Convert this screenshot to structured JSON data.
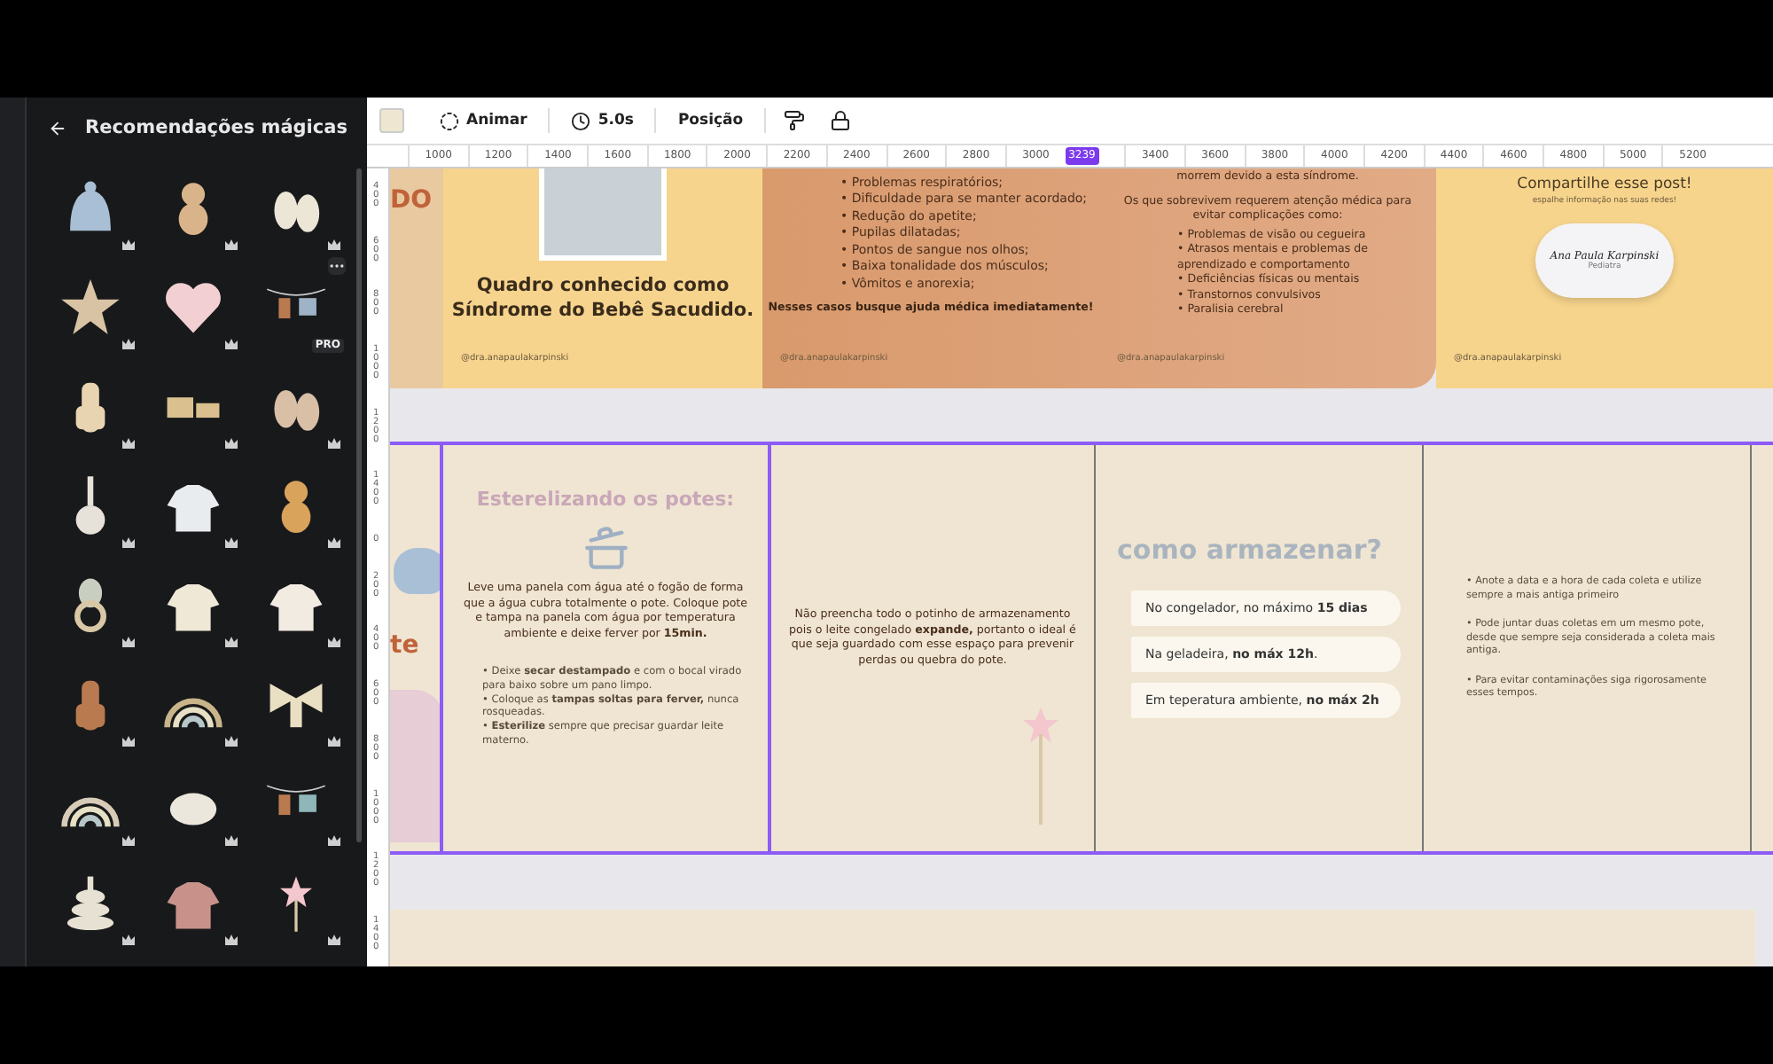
{
  "sidebar": {
    "title": "Recomendações mágicas",
    "stickers": [
      {
        "kind": "hat",
        "hovered": false
      },
      {
        "kind": "bear",
        "hovered": false
      },
      {
        "kind": "booties",
        "hovered": false
      },
      {
        "kind": "star",
        "hovered": false
      },
      {
        "kind": "heart",
        "hovered": false
      },
      {
        "kind": "clothesline",
        "hovered": true,
        "label": "PRO"
      },
      {
        "kind": "giraffe",
        "hovered": false
      },
      {
        "kind": "train",
        "hovered": false
      },
      {
        "kind": "slippers",
        "hovered": false
      },
      {
        "kind": "guitar",
        "hovered": false
      },
      {
        "kind": "sweater",
        "hovered": false
      },
      {
        "kind": "teddy",
        "hovered": false
      },
      {
        "kind": "teether",
        "hovered": false
      },
      {
        "kind": "dress",
        "hovered": false
      },
      {
        "kind": "romper",
        "hovered": false
      },
      {
        "kind": "overalls",
        "hovered": false
      },
      {
        "kind": "rainbow",
        "hovered": false
      },
      {
        "kind": "bow",
        "hovered": false
      },
      {
        "kind": "arch",
        "hovered": false
      },
      {
        "kind": "swan",
        "hovered": false
      },
      {
        "kind": "swing",
        "hovered": false
      },
      {
        "kind": "stacker",
        "hovered": false
      },
      {
        "kind": "frock",
        "hovered": false
      },
      {
        "kind": "wand",
        "hovered": false
      }
    ]
  },
  "toolbar": {
    "buttons": [
      {
        "kind": "swatch"
      },
      {
        "kind": "animate",
        "label": "Animar"
      },
      {
        "kind": "duration",
        "label": "5.0s"
      },
      {
        "kind": "text",
        "label": "Posição"
      },
      {
        "kind": "paint"
      },
      {
        "kind": "lock"
      }
    ]
  },
  "ruler": {
    "ticks": [
      {
        "kind": "tick",
        "label": "1000"
      },
      {
        "kind": "tick",
        "label": "1200"
      },
      {
        "kind": "tick",
        "label": "1400"
      },
      {
        "kind": "tick",
        "label": "1600"
      },
      {
        "kind": "tick",
        "label": "1800"
      },
      {
        "kind": "tick",
        "label": "2000"
      },
      {
        "kind": "tick",
        "label": "2200"
      },
      {
        "kind": "tick",
        "label": "2400"
      },
      {
        "kind": "tick",
        "label": "2600"
      },
      {
        "kind": "tick",
        "label": "2800"
      },
      {
        "kind": "tick",
        "label": "3000"
      },
      {
        "kind": "marker",
        "label": "3239"
      },
      {
        "kind": "tick",
        "label": "3400"
      },
      {
        "kind": "tick",
        "label": "3600"
      },
      {
        "kind": "tick",
        "label": "3800"
      },
      {
        "kind": "tick",
        "label": "4000"
      },
      {
        "kind": "tick",
        "label": "4200"
      },
      {
        "kind": "tick",
        "label": "4400"
      },
      {
        "kind": "tick",
        "label": "4600"
      },
      {
        "kind": "tick",
        "label": "4800"
      },
      {
        "kind": "tick",
        "label": "5000"
      },
      {
        "kind": "tick",
        "label": "5200"
      }
    ]
  },
  "vertical_ruler": {
    "ticks": [
      "400",
      "600",
      "800",
      "1000",
      "1200",
      "1400",
      "0",
      "200",
      "400",
      "600",
      "800",
      "1000",
      "1200",
      "1400"
    ]
  },
  "pages_top": [
    {
      "kind": "peek",
      "heading": "DO"
    },
    {
      "kind": "photo_title",
      "title": "Quadro conhecido como Síndrome do Bebê Sacudido.",
      "handle": "@dra.anapaulakarpinski"
    },
    {
      "kind": "list",
      "items": [
        "• Problemas respiratórios;",
        "• Dificuldade para se manter acordado;",
        "• Redução do apetite;",
        "• Pupilas dilatadas;",
        "• Pontos de sangue nos olhos;",
        "• Baixa tonalidade dos músculos;",
        "• Vômitos e anorexia;"
      ],
      "note": "Nesses casos busque ajuda médica imediatamente!",
      "handle": "@dra.anapaulakarpinski"
    },
    {
      "kind": "text_list",
      "intro": "morrem devido a esta síndrome.",
      "paragraph": "Os que sobrevivem requerem atenção médica para evitar complicações como:",
      "items": [
        "• Problemas de visão ou cegueira",
        "• Atrasos mentais e problemas de aprendizado e comportamento",
        "• Deficiências físicas ou mentais",
        "• Transtornos convulsivos",
        "• Paralisia cerebral"
      ],
      "handle": "@dra.anapaulakarpinski"
    },
    {
      "kind": "share",
      "title": "Compartilhe esse post!",
      "subtitle": "espalhe informação nas suas redes!",
      "signature": "Ana Paula Karpinski",
      "role": "Pediatra",
      "handle": "@dra.anapaulakarpinski"
    }
  ],
  "pages_bottom": [
    {
      "kind": "peek",
      "heading": "te"
    },
    {
      "kind": "steps",
      "title": "Esterelizando os potes:",
      "paragraph": "Leve uma panela com água até o fogão de forma que a água cubra totalmente o pote. Coloque pote e tampa na panela com água por temperatura ambiente e deixe ferver por **15min.**",
      "items": [
        "• Deixe **secar destampado** e com o bocal virado para baixo sobre um pano limpo.",
        "• Coloque as **tampas soltas para ferver,** nunca rosqueadas.",
        "• **Esterilize** sempre que precisar guardar leite materno."
      ]
    },
    {
      "kind": "note",
      "paragraph": "Não preencha todo o potinho de armazenamento pois o leite congelado **expande,** portanto o ideal é que seja guardado com esse espaço para prevenir perdas ou quebra do pote."
    },
    {
      "kind": "pills",
      "title": "como armazenar?",
      "items": [
        "No congelador, no máximo **15 dias**",
        "Na geladeira, **no máx 12h**.",
        "Em teperatura ambiente, **no máx 2h**"
      ]
    },
    {
      "kind": "bullets",
      "items": [
        "• Anote a data e a hora de cada coleta e utilize sempre a mais antiga primeiro",
        "• Pode juntar duas coletas em um mesmo pote, desde que sempre seja considerada a coleta mais antiga.",
        "• Para evitar contaminações siga rigorosamente esses tempos."
      ]
    }
  ]
}
